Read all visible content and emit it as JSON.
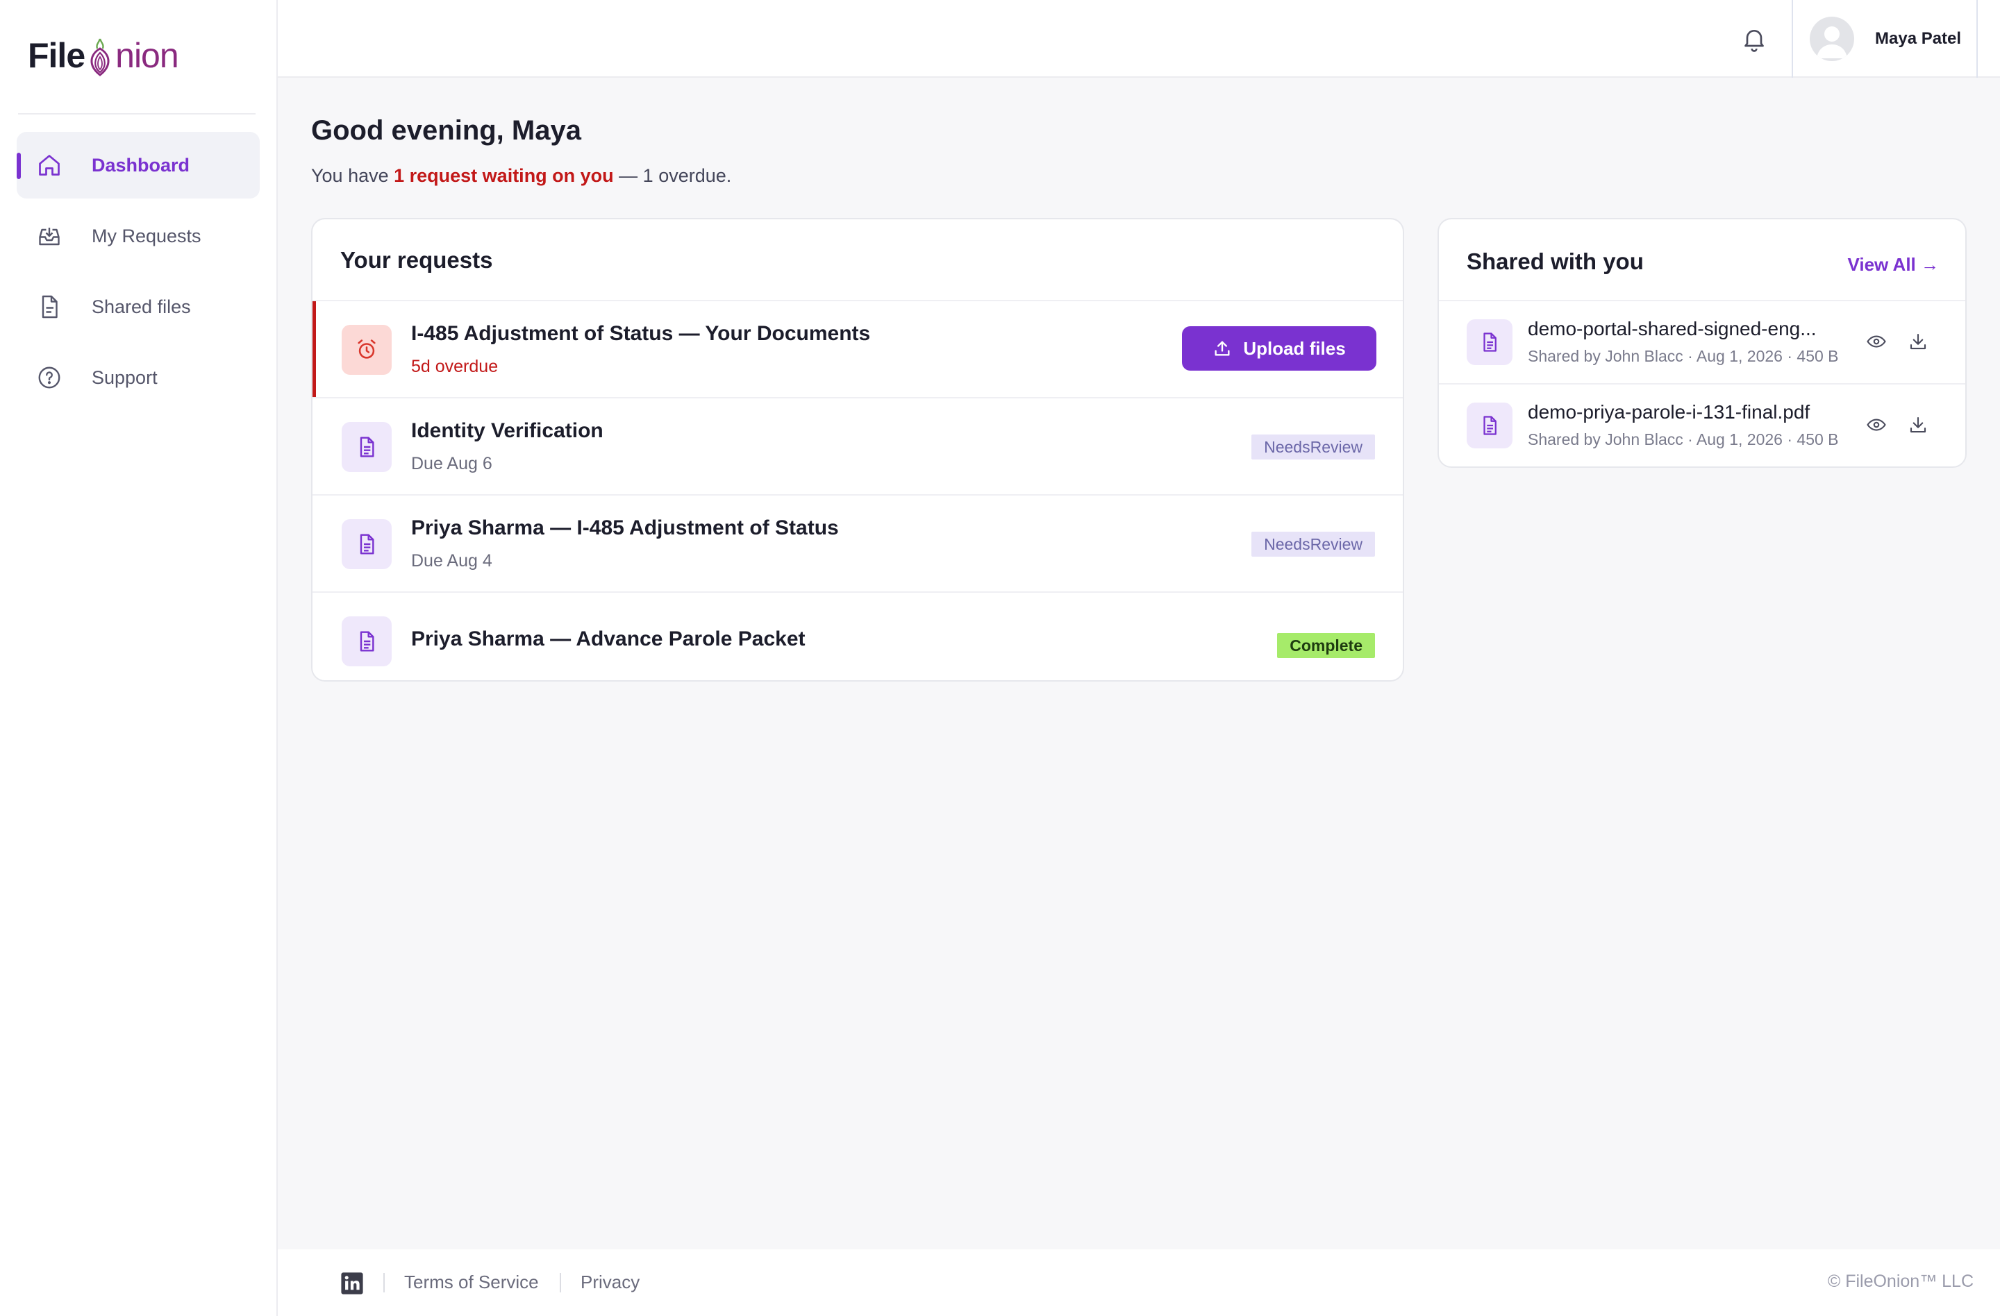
{
  "brand": {
    "name_part1": "File",
    "name_part2": "nion",
    "accent": "#7a32d0"
  },
  "sidebar": {
    "items": [
      {
        "label": "Dashboard",
        "icon": "home-icon",
        "active": true
      },
      {
        "label": "My Requests",
        "icon": "inbox-icon",
        "active": false
      },
      {
        "label": "Shared files",
        "icon": "file-icon",
        "active": false
      },
      {
        "label": "Support",
        "icon": "help-circle-icon",
        "active": false
      }
    ]
  },
  "header": {
    "user_name": "Maya Patel",
    "notification_icon": "bell-icon"
  },
  "greeting": {
    "title": "Good evening, Maya",
    "prefix": "You have ",
    "highlight": "1 request waiting on you",
    "suffix": " — 1 overdue."
  },
  "requests": {
    "title": "Your requests",
    "items": [
      {
        "title": "I-485 Adjustment of Status — Your Documents",
        "subtitle": "5d overdue",
        "action": "Upload files",
        "status": "overdue"
      },
      {
        "title": "Identity Verification",
        "subtitle": "Due Aug 6",
        "badge": "NeedsReview"
      },
      {
        "title": "Priya Sharma — I-485 Adjustment of Status",
        "subtitle": "Due Aug 4",
        "badge": "NeedsReview"
      },
      {
        "title": "Priya Sharma — Advance Parole Packet",
        "badge": "Complete"
      }
    ]
  },
  "shared": {
    "title": "Shared with you",
    "view_all": "View All →",
    "items": [
      {
        "name": "demo-portal-shared-signed-eng...",
        "meta": "Shared by John Blacc · Aug 1, 2026 · 450 B"
      },
      {
        "name": "demo-priya-parole-i-131-final.pdf",
        "meta": "Shared by John Blacc · Aug 1, 2026 · 450 B"
      }
    ]
  },
  "footer": {
    "terms": "Terms of Service",
    "privacy": "Privacy",
    "copyright": "© FileOnion™ LLC"
  }
}
